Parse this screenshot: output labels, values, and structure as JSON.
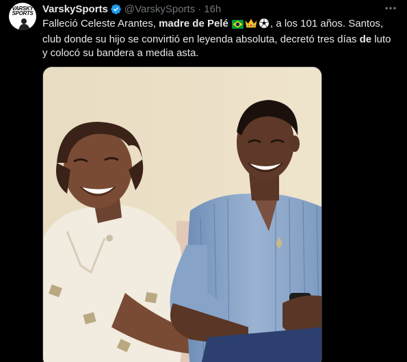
{
  "tweet": {
    "author": {
      "display_name": "VarskySports",
      "handle": "@VarskySports",
      "avatar_logo_line1": "VARSKY",
      "avatar_logo_line2": "SPORTS",
      "verified": true
    },
    "separator": "·",
    "time": "16h",
    "text": {
      "part1": "Falleció Celeste Arantes, ",
      "bold1": "madre de Pelé",
      "emojis": [
        "brazil-flag",
        "crown",
        "soccer-ball"
      ],
      "part2": ", a los 101 años. Santos, club donde su hijo se convirtió en leyenda absoluta, decretó tres días ",
      "bold2": "de",
      "part3": " luto y colocó su bandera a media asta."
    },
    "media": {
      "type": "photo",
      "subject": "Celeste Arantes and Pelé laughing"
    }
  },
  "colors": {
    "background": "#000000",
    "text_primary": "#e7e9ea",
    "text_secondary": "#71767b",
    "verified": "#1d9bf0"
  }
}
